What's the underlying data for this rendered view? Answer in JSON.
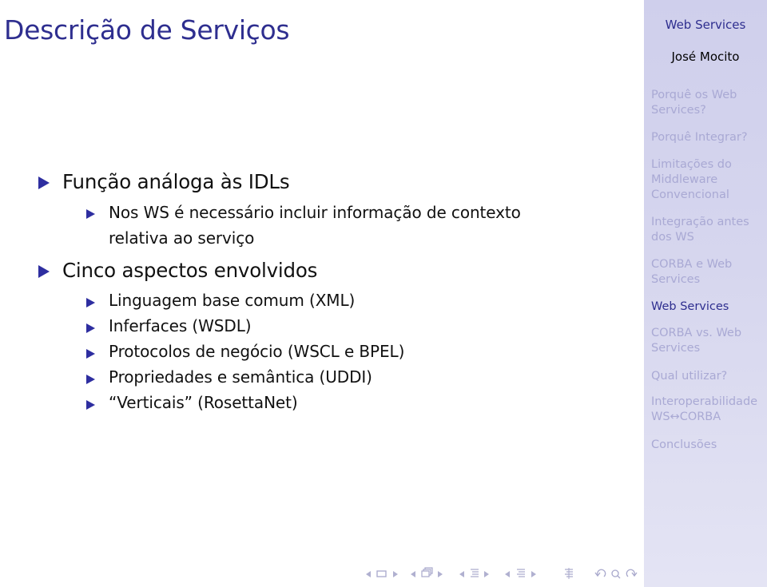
{
  "frame": {
    "title": "Descrição de Serviços"
  },
  "content": {
    "items": [
      {
        "level": 1,
        "text": "Função análoga às IDLs"
      },
      {
        "level": 2,
        "text": "Nos WS é necessário incluir informação de contexto",
        "continuation": "relativa ao serviço"
      },
      {
        "level": 1,
        "text": "Cinco aspectos envolvidos"
      },
      {
        "level": 2,
        "text": "Linguagem base comum (XML)"
      },
      {
        "level": 2,
        "text": "Inferfaces (WSDL)"
      },
      {
        "level": 2,
        "text": "Protocolos de negócio (WSCL e BPEL)"
      },
      {
        "level": 2,
        "text": "Propriedades e semântica (UDDI)"
      },
      {
        "level": 2,
        "text": "“Verticais” (RosettaNet)"
      }
    ]
  },
  "sidebar": {
    "title": "Web Services",
    "author": "José Mocito",
    "sections": [
      {
        "label": "Porquê os Web Services?",
        "active": false
      },
      {
        "label": "Porquê Integrar?",
        "active": false
      },
      {
        "label": "Limitações do Middleware Convencional",
        "active": false
      },
      {
        "label": "Integração antes dos WS",
        "active": false
      },
      {
        "label": "CORBA e Web Services",
        "active": false
      },
      {
        "label": "Web Services",
        "active": true
      },
      {
        "label": "CORBA vs. Web Services",
        "active": false
      },
      {
        "label": "Qual utilizar?",
        "active": false
      },
      {
        "label": "Interoperabilidade WS↔CORBA",
        "active": false
      },
      {
        "label": "Conclusões",
        "active": false
      }
    ],
    "colors": {
      "active": "#2e2e8f",
      "inactive": "#a9a9d4"
    }
  },
  "navigation": {
    "icons": [
      "frame-prev",
      "frame-icon",
      "frame-next",
      "subsection-prev",
      "subsection-icon",
      "subsection-next",
      "section-prev",
      "section-icon",
      "section-next",
      "doc-prev",
      "doc-icon",
      "doc-next",
      "appendix-icon",
      "back-icon",
      "search-icon",
      "forward-icon"
    ]
  }
}
